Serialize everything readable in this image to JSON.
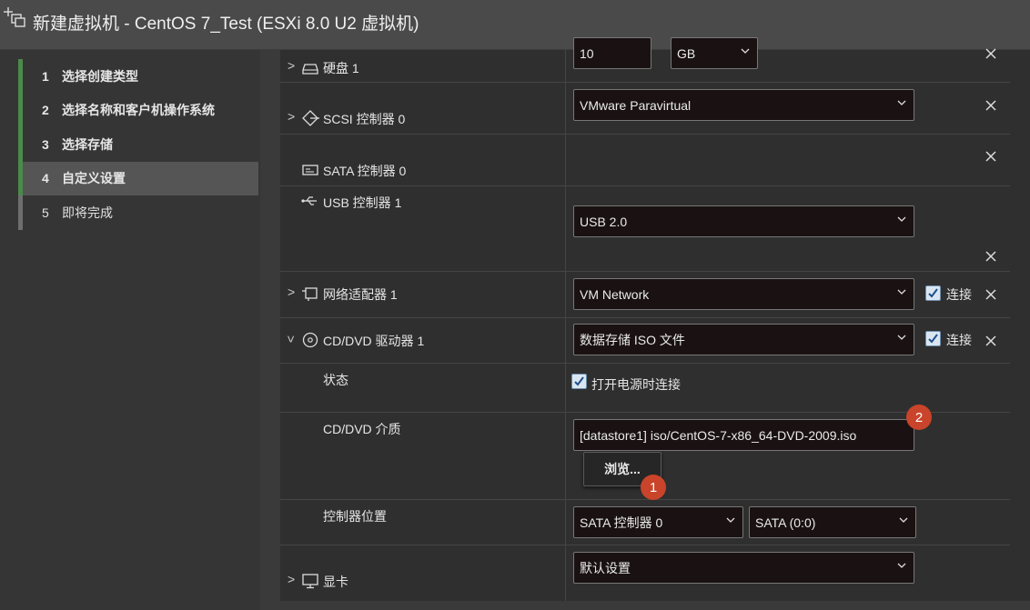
{
  "window": {
    "title": "新建虚拟机 - CentOS 7_Test (ESXi 8.0 U2 虚拟机)"
  },
  "steps": [
    {
      "num": "1",
      "label": "选择创建类型"
    },
    {
      "num": "2",
      "label": "选择名称和客户机操作系统"
    },
    {
      "num": "3",
      "label": "选择存储"
    },
    {
      "num": "4",
      "label": "自定义设置"
    },
    {
      "num": "5",
      "label": "即将完成"
    }
  ],
  "hardware": {
    "disk": {
      "label": "硬盘 1",
      "size_value": "10",
      "size_unit": "GB"
    },
    "scsi": {
      "label": "SCSI 控制器 0",
      "value": "VMware Paravirtual"
    },
    "sata": {
      "label": "SATA 控制器 0"
    },
    "usb": {
      "label": "USB 控制器 1",
      "value": "USB 2.0"
    },
    "network": {
      "label": "网络适配器 1",
      "value": "VM Network",
      "connect_label": "连接"
    },
    "cdrom": {
      "label": "CD/DVD 驱动器 1",
      "value": "数据存储 ISO 文件",
      "connect_label": "连接",
      "status_label": "状态",
      "power_on_connect_label": "打开电源时连接",
      "media_label": "CD/DVD 介质",
      "media_path": "[datastore1] iso/CentOS-7-x86_64-DVD-2009.iso",
      "browse_label": "浏览...",
      "controller_location_label": "控制器位置",
      "controller_value": "SATA 控制器 0",
      "slot_value": "SATA (0:0)"
    },
    "video": {
      "label": "显卡",
      "value": "默认设置"
    }
  },
  "badges": {
    "browse_badge": "1",
    "media_badge": "2"
  },
  "colors": {
    "accent_green": "#4c8a4a",
    "badge_red": "#c9442a",
    "checkbox_blue": "#d9e6f2"
  }
}
